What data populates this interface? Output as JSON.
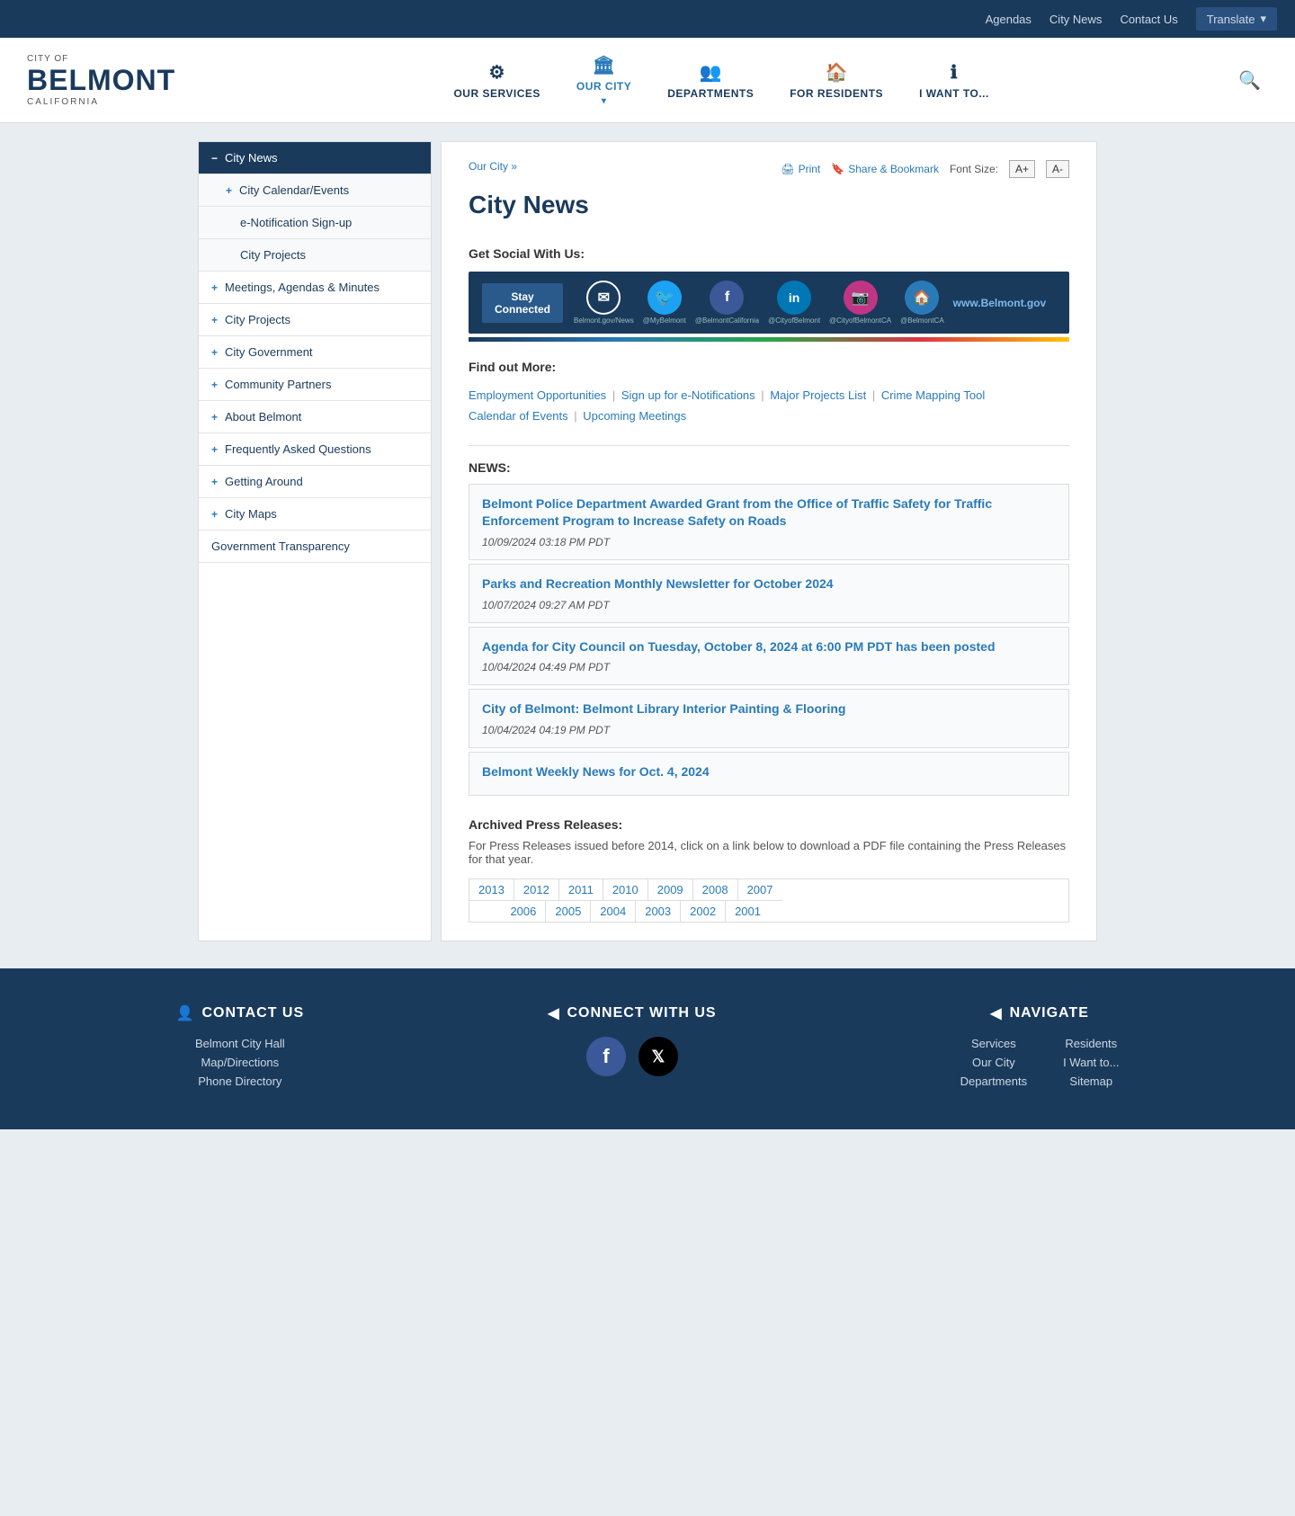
{
  "topbar": {
    "links": [
      "Agendas",
      "City News",
      "Contact Us"
    ],
    "translate_label": "Translate"
  },
  "header": {
    "logo": {
      "city_of": "CITY OF",
      "belmont": "BELMONT",
      "california": "CALIFORNIA"
    },
    "nav": [
      {
        "id": "our-services",
        "label": "OUR SERVICES",
        "icon": "⚙",
        "has_dropdown": false
      },
      {
        "id": "our-city",
        "label": "OUR CITY",
        "icon": "🏛",
        "has_dropdown": true
      },
      {
        "id": "departments",
        "label": "DEPARTMENTS",
        "icon": "👥",
        "has_dropdown": false
      },
      {
        "id": "for-residents",
        "label": "FOR RESIDENTS",
        "icon": "🏠",
        "has_dropdown": false
      },
      {
        "id": "i-want-to",
        "label": "I WANT TO...",
        "icon": "ℹ",
        "has_dropdown": false
      }
    ]
  },
  "sidebar": {
    "items": [
      {
        "id": "city-news",
        "label": "City News",
        "active": true,
        "level": 0,
        "toggle": "−"
      },
      {
        "id": "city-calendar",
        "label": "City Calendar/Events",
        "level": 1,
        "toggle": "+"
      },
      {
        "id": "e-notification",
        "label": "e-Notification Sign-up",
        "level": 2,
        "toggle": ""
      },
      {
        "id": "city-projects-sub",
        "label": "City Projects",
        "level": 2,
        "toggle": ""
      },
      {
        "id": "meetings-agendas",
        "label": "Meetings, Agendas & Minutes",
        "level": 0,
        "toggle": "+"
      },
      {
        "id": "city-projects",
        "label": "City Projects",
        "level": 0,
        "toggle": "+"
      },
      {
        "id": "city-government",
        "label": "City Government",
        "level": 0,
        "toggle": "+"
      },
      {
        "id": "community-partners",
        "label": "Community Partners",
        "level": 0,
        "toggle": "+"
      },
      {
        "id": "about-belmont",
        "label": "About Belmont",
        "level": 0,
        "toggle": "+"
      },
      {
        "id": "faq",
        "label": "Frequently Asked Questions",
        "level": 0,
        "toggle": "+"
      },
      {
        "id": "getting-around",
        "label": "Getting Around",
        "level": 0,
        "toggle": "+"
      },
      {
        "id": "city-maps",
        "label": "City Maps",
        "level": 0,
        "toggle": "+"
      },
      {
        "id": "gov-transparency",
        "label": "Government Transparency",
        "level": 0,
        "toggle": ""
      }
    ]
  },
  "breadcrumb": {
    "parent": "Our City",
    "separator": "»"
  },
  "toolbar": {
    "print_label": "Print",
    "share_label": "Share & Bookmark",
    "font_size_label": "Font Size:",
    "font_increase": "A+",
    "font_decrease": "A-"
  },
  "page_title": "City News",
  "social_section": {
    "label": "Get Social With Us:",
    "stay_connected": "Stay\nConnected",
    "items": [
      {
        "id": "email",
        "icon": "✉",
        "color": "#1a3a5c",
        "handle": "Belmont.gov/News"
      },
      {
        "id": "twitter",
        "icon": "🐦",
        "color": "#1da1f2",
        "handle": "@MyBelmont"
      },
      {
        "id": "facebook",
        "icon": "f",
        "color": "#3b5998",
        "handle": "@BelmontCalifornia"
      },
      {
        "id": "linkedin",
        "icon": "in",
        "color": "#0077b5",
        "handle": "@CityofBelmont"
      },
      {
        "id": "instagram",
        "icon": "📷",
        "color": "#c13584",
        "handle": "@CityofBelmontCA"
      },
      {
        "id": "website",
        "icon": "🏠",
        "color": "#2a7ab8",
        "handle": "@BelmontCA"
      }
    ],
    "website_url": "www.Belmont.gov"
  },
  "find_more": {
    "label": "Find out More:",
    "links": [
      {
        "id": "employment",
        "label": "Employment Opportunities"
      },
      {
        "id": "enotification",
        "label": "Sign up for e-Notifications"
      },
      {
        "id": "major-projects",
        "label": "Major Projects List"
      },
      {
        "id": "crime-mapping",
        "label": "Crime Mapping Tool"
      },
      {
        "id": "calendar",
        "label": "Calendar of Events"
      },
      {
        "id": "upcoming-meetings",
        "label": "Upcoming Meetings"
      }
    ]
  },
  "news": {
    "label": "NEWS:",
    "items": [
      {
        "id": "news-1",
        "title": "Belmont Police Department Awarded Grant from the Office of Traffic Safety for Traffic Enforcement Program to Increase Safety on Roads",
        "date": "10/09/2024 03:18 PM PDT"
      },
      {
        "id": "news-2",
        "title": "Parks and Recreation Monthly Newsletter for October 2024",
        "date": "10/07/2024 09:27 AM PDT"
      },
      {
        "id": "news-3",
        "title": "Agenda for City Council on Tuesday, October 8, 2024 at 6:00 PM PDT has been posted",
        "date": "10/04/2024 04:49 PM PDT"
      },
      {
        "id": "news-4",
        "title": "City of Belmont: Belmont Library Interior Painting & Flooring",
        "date": "10/04/2024 04:19 PM PDT"
      },
      {
        "id": "news-5",
        "title": "Belmont Weekly News for Oct. 4, 2024",
        "date": ""
      }
    ]
  },
  "archived": {
    "title": "Archived Press Releases:",
    "description": "For Press Releases issued before 2014, click on a link below to download a PDF file containing the Press Releases for that year.",
    "years_row1": [
      "2013",
      "2012",
      "2011",
      "2010",
      "2009",
      "2008",
      "2007"
    ],
    "years_row2": [
      "2006",
      "2005",
      "2004",
      "2003",
      "2002",
      "2001"
    ]
  },
  "footer": {
    "contact": {
      "title": "CONTACT US",
      "icon": "👤",
      "links": [
        "Belmont City Hall",
        "Map/Directions",
        "Phone Directory"
      ]
    },
    "connect": {
      "title": "CONNECT WITH US",
      "icon": "◀",
      "social": [
        "facebook",
        "x-twitter"
      ]
    },
    "navigate": {
      "title": "NAVIGATE",
      "icon": "◀",
      "col1": [
        "Services",
        "Our City",
        "Departments"
      ],
      "col2": [
        "Residents",
        "I Want to...",
        "Sitemap"
      ]
    }
  }
}
